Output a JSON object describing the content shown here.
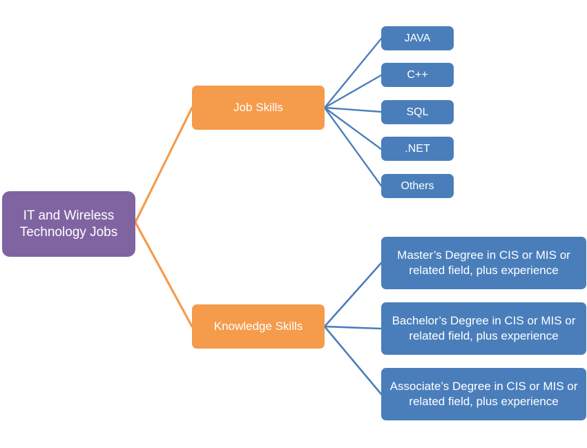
{
  "diagram": {
    "title": "IT and Wireless Technology Jobs",
    "type": "hierarchy-tree",
    "colors": {
      "root": "#8064A2",
      "branch": "#F59B4C",
      "leaf": "#4A7EBB",
      "root_connector": "#F59B4C",
      "leaf_connector": "#4A7EBB",
      "background": "#FFFFFF",
      "text": "#FFFFFF"
    },
    "root": {
      "label": "IT and Wireless\nTechnology Jobs"
    },
    "branches": [
      {
        "id": "job-skills",
        "label": "Job Skills",
        "children": [
          {
            "id": "java",
            "label": "JAVA"
          },
          {
            "id": "cpp",
            "label": "C++"
          },
          {
            "id": "sql",
            "label": "SQL"
          },
          {
            "id": "dotnet",
            "label": ".NET"
          },
          {
            "id": "others",
            "label": "Others"
          }
        ]
      },
      {
        "id": "knowledge-skills",
        "label": "Knowledge Skills",
        "children": [
          {
            "id": "masters",
            "label": "Master’s Degree in CIS or MIS or related field,  plus experience"
          },
          {
            "id": "bachelors",
            "label": "Bachelor’s Degree in CIS or MIS or related field,  plus experience"
          },
          {
            "id": "associates",
            "label": "Associate’s Degree in CIS or MIS or related field,  plus experience"
          }
        ]
      }
    ]
  }
}
